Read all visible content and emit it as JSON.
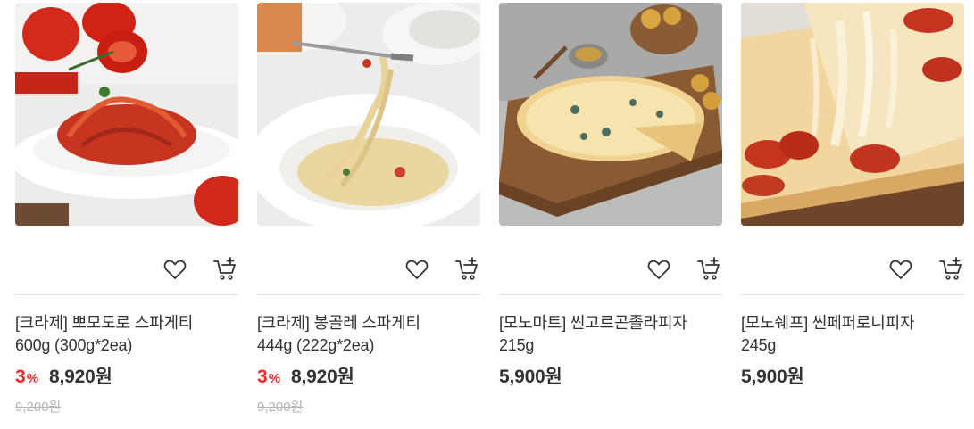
{
  "products": [
    {
      "name_line1": "[크라제] 뽀모도로 스파게티",
      "name_line2": "600g (300g*2ea)",
      "discount_rate": "3",
      "discount_unit": "%",
      "price": "8,920원",
      "original_price": "9,200원",
      "image": "tomato-spaghetti-photo"
    },
    {
      "name_line1": "[크라제] 봉골레 스파게티",
      "name_line2": "444g (222g*2ea)",
      "discount_rate": "3",
      "discount_unit": "%",
      "price": "8,920원",
      "original_price": "9,200원",
      "image": "vongole-spaghetti-photo"
    },
    {
      "name_line1": "[모노마트] 씬고르곤졸라피자",
      "name_line2": "215g",
      "price": "5,900원",
      "image": "gorgonzola-pizza-photo"
    },
    {
      "name_line1": "[모노쉐프] 씬페퍼로니피자",
      "name_line2": "245g",
      "price": "5,900원",
      "image": "pepperoni-pizza-photo"
    }
  ],
  "icons": {
    "wishlist": "heart-outline-icon",
    "cart": "cart-plus-icon"
  },
  "colors": {
    "discount": "#fa2828",
    "text": "#333333",
    "strike": "#b5b5b5",
    "divider": "#e3e3e3"
  }
}
